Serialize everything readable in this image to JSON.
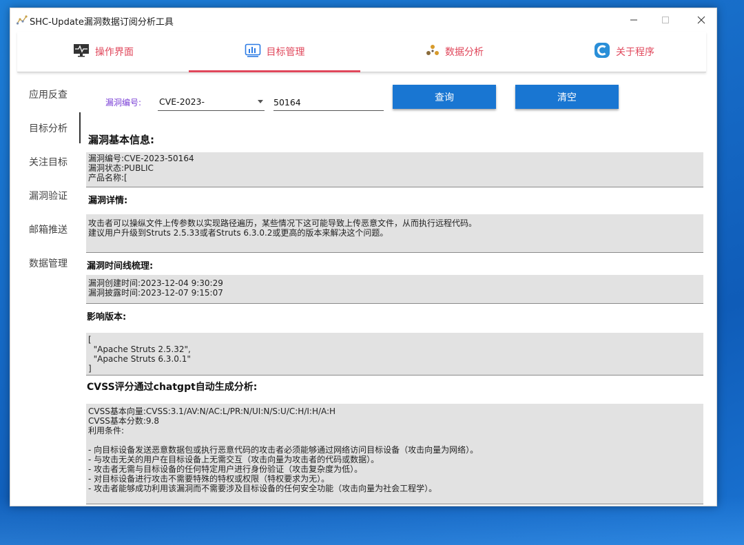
{
  "window": {
    "title": "SHC-Update漏洞数据订阅分析工具"
  },
  "topnav": {
    "tabs": [
      {
        "label": "操作界面",
        "icon": "monitor-icon"
      },
      {
        "label": "目标管理",
        "icon": "chart-panel-icon"
      },
      {
        "label": "数据分析",
        "icon": "cluster-icon"
      },
      {
        "label": "关于程序",
        "icon": "c-logo-icon"
      }
    ],
    "active_index": 1,
    "accent_color": "#e0475b"
  },
  "sidebar": {
    "items": [
      "应用反查",
      "目标分析",
      "关注目标",
      "漏洞验证",
      "邮箱推送",
      "数据管理"
    ],
    "active_index": 1
  },
  "query": {
    "label": "漏洞编号:",
    "prefix_value": "CVE-2023-",
    "number_value": "50164",
    "query_button": "查询",
    "clear_button": "清空",
    "button_color": "#1976d2"
  },
  "sections": {
    "basic": {
      "title": "漏洞基本信息:",
      "lines": [
        "漏洞编号:CVE-2023-50164",
        "漏洞状态:PUBLIC",
        "产品名称:["
      ]
    },
    "detail": {
      "title": "漏洞详情:",
      "lines": [
        "攻击者可以操纵文件上传参数以实现路径遍历，某些情况下这可能导致上传恶意文件，从而执行远程代码。",
        "建议用户升级到Struts 2.5.33或者Struts 6.3.0.2或更高的版本来解决这个问题。"
      ]
    },
    "timeline": {
      "title": "漏洞时间线梳理:",
      "lines": [
        "漏洞创建时间:2023-12-04 9:30:29",
        "漏洞披露时间:2023-12-07 9:15:07"
      ]
    },
    "versions": {
      "title": "影响版本:",
      "lines": [
        "[",
        "  \"Apache Struts 2.5.32\",",
        "  \"Apache Struts 6.3.0.1\"",
        "]"
      ]
    },
    "cvss": {
      "title": "CVSS评分通过chatgpt自动生成分析:",
      "lines": [
        "CVSS基本向量:CVSS:3.1/AV:N/AC:L/PR:N/UI:N/S:U/C:H/I:H/A:H",
        "CVSS基本分数:9.8",
        "利用条件:",
        "",
        "- 向目标设备发送恶意数据包或执行恶意代码的攻击者必须能够通过网络访问目标设备（攻击向量为网络）。",
        "- 与攻击无关的用户在目标设备上无需交互（攻击向量为攻击者的代码或数据）。",
        "- 攻击者无需与目标设备的任何特定用户进行身份验证（攻击复杂度为低）。",
        "- 对目标设备进行攻击不需要特殊的特权或权限（特权要求为无）。",
        "- 攻击者能够成功利用该漏洞而不需要涉及目标设备的任何安全功能（攻击向量为社会工程学）。"
      ]
    }
  }
}
